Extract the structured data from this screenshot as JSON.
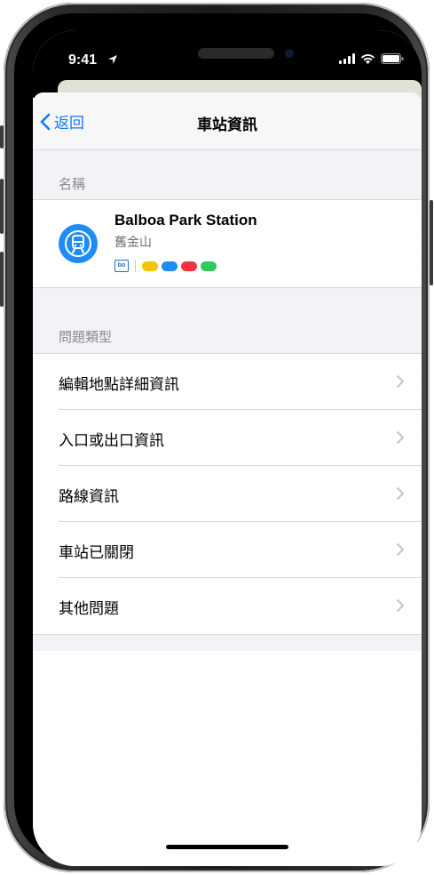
{
  "status_bar": {
    "time": "9:41"
  },
  "nav": {
    "back_label": "返回",
    "title": "車站資訊"
  },
  "name_section": {
    "header": "名稱",
    "station": {
      "name": "Balboa Park Station",
      "subtitle": "舊金山",
      "operator_badge": "bo",
      "line_colors": [
        "#f5c400",
        "#1f8cf5",
        "#ef3340",
        "#34c759"
      ]
    }
  },
  "issue_section": {
    "header": "問題類型",
    "items": [
      {
        "label": "編輯地點詳細資訊"
      },
      {
        "label": "入口或出口資訊"
      },
      {
        "label": "路線資訊"
      },
      {
        "label": "車站已關閉"
      },
      {
        "label": "其他問題"
      }
    ]
  },
  "colors": {
    "accent": "#0a7aff",
    "station_icon_bg": "#1f8cf5"
  }
}
